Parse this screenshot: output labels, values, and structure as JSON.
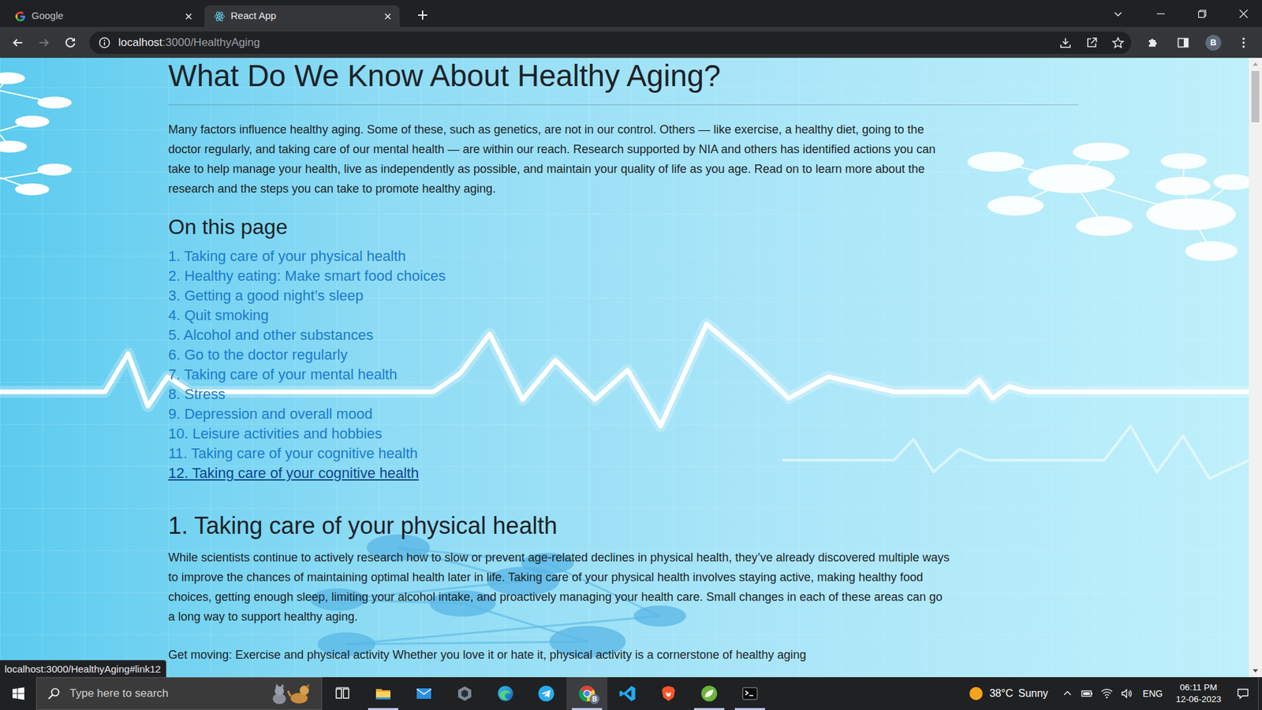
{
  "browser": {
    "tabs": [
      {
        "label": "Google",
        "selected": false,
        "kind": "google"
      },
      {
        "label": "React App",
        "selected": true,
        "kind": "react"
      }
    ],
    "address": {
      "host": "localhost",
      "path": ":3000/HealthyAging"
    },
    "profile": "B",
    "status_url": "localhost:3000/HealthyAging#link12"
  },
  "page": {
    "title": "What Do We Know About Healthy Aging?",
    "intro": "Many factors influence healthy aging. Some of these, such as genetics, are not in our control. Others — like exercise, a healthy diet, going to the doctor regularly, and taking care of our mental health — are within our reach. Research supported by NIA and others has identified actions you can take to help manage your health, live as independently as possible, and maintain your quality of life as you age. Read on to learn more about the research and the steps you can take to promote healthy aging.",
    "toc_title": "On this page",
    "toc": [
      {
        "label": "1. Taking care of your physical health",
        "hovered": false
      },
      {
        "label": "2. Healthy eating: Make smart food choices",
        "hovered": false
      },
      {
        "label": "3. Getting a good night’s sleep",
        "hovered": false
      },
      {
        "label": "4. Quit smoking",
        "hovered": false
      },
      {
        "label": "5. Alcohol and other substances",
        "hovered": false
      },
      {
        "label": "6. Go to the doctor regularly",
        "hovered": false
      },
      {
        "label": "7. Taking care of your mental health",
        "hovered": false
      },
      {
        "label": "8. Stress",
        "hovered": false
      },
      {
        "label": "9. Depression and overall mood",
        "hovered": false
      },
      {
        "label": "10. Leisure activities and hobbies",
        "hovered": false
      },
      {
        "label": "11. Taking care of your cognitive health",
        "hovered": false
      },
      {
        "label": "12. Taking care of your cognitive health",
        "hovered": true
      }
    ],
    "section": {
      "heading": "1. Taking care of your physical health",
      "body": "While scientists continue to actively research how to slow or prevent age-related declines in physical health, they’ve already discovered multiple ways to improve the chances of maintaining optimal health later in life. Taking care of your physical health involves staying active, making healthy food choices, getting enough sleep, limiting your alcohol intake, and proactively managing your health care. Small changes in each of these areas can go a long way to support healthy aging."
    },
    "next_line": "Get moving: Exercise and physical activity Whether you love it or hate it, physical activity is a cornerstone of healthy aging"
  },
  "taskbar": {
    "search_placeholder": "Type here to search",
    "apps": [
      {
        "kind": "taskview",
        "running": false,
        "selected": false
      },
      {
        "kind": "folder",
        "running": true,
        "selected": false
      },
      {
        "kind": "mail",
        "running": false,
        "selected": false
      },
      {
        "kind": "hexagon",
        "running": false,
        "selected": false
      },
      {
        "kind": "edge",
        "running": false,
        "selected": false
      },
      {
        "kind": "telegram",
        "running": false,
        "selected": false
      },
      {
        "kind": "chrome",
        "running": true,
        "selected": true,
        "badge": "B"
      },
      {
        "kind": "vscode",
        "running": false,
        "selected": false
      },
      {
        "kind": "brave",
        "running": false,
        "selected": false
      },
      {
        "kind": "spring",
        "running": true,
        "selected": false
      },
      {
        "kind": "terminal",
        "running": true,
        "selected": false
      }
    ],
    "weather": {
      "temp": "38°C",
      "condition": "Sunny"
    },
    "language": "ENG",
    "time": "06:11 PM",
    "date": "12-06-2023"
  }
}
